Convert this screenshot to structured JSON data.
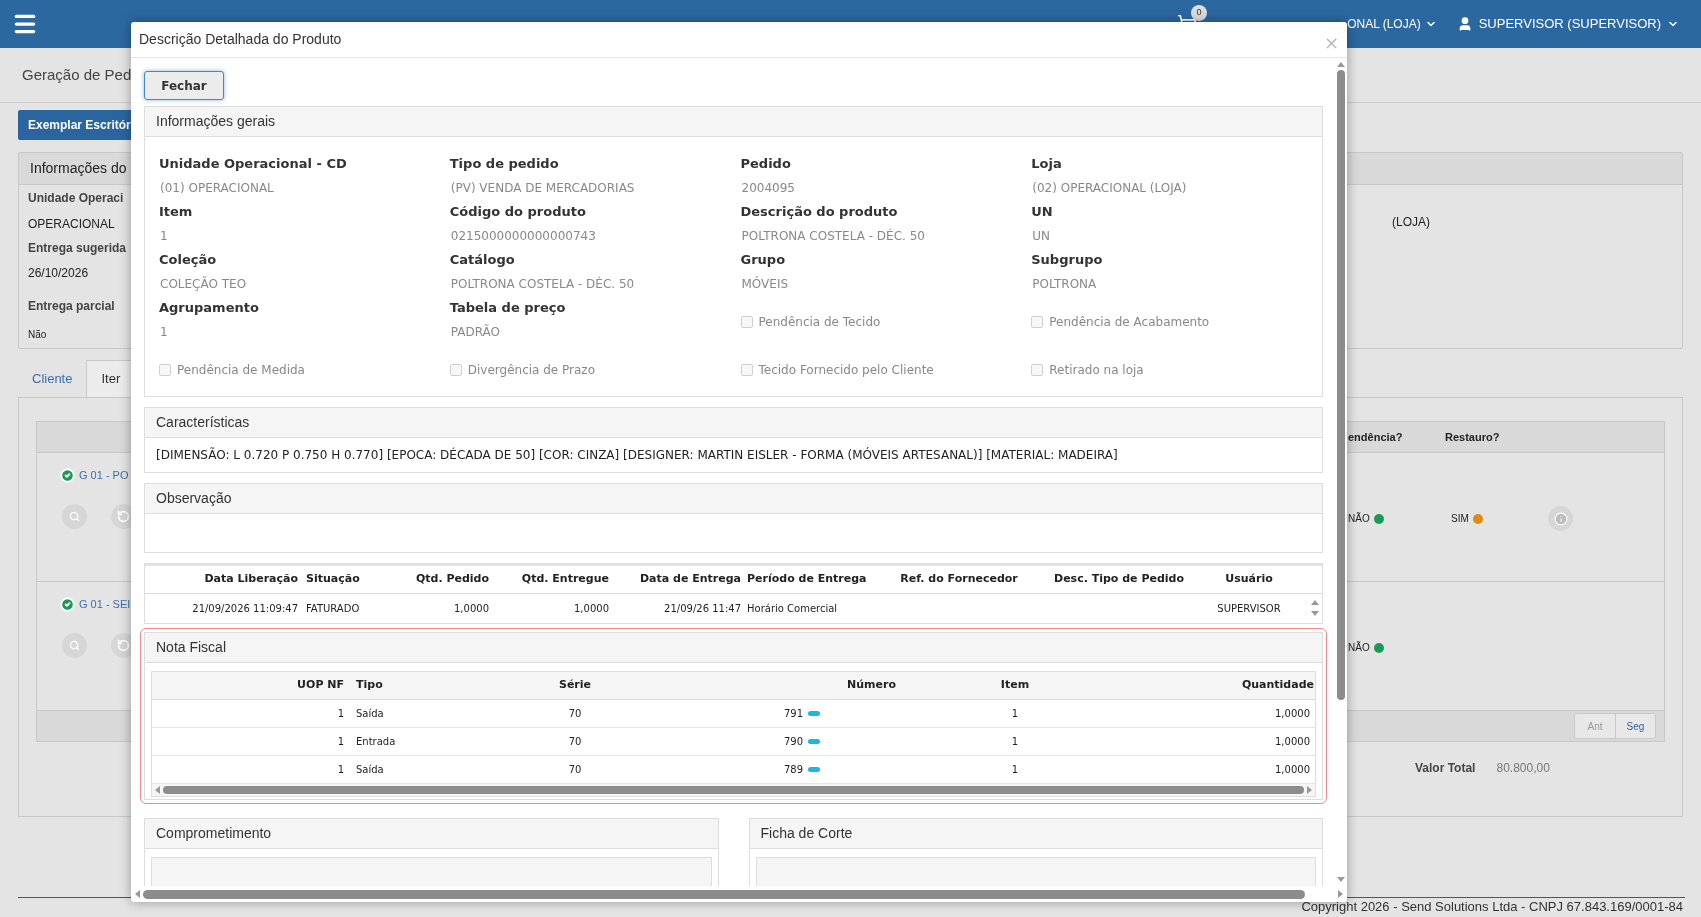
{
  "topbar": {
    "cart_count": "0",
    "store": "ONAL (LOJA)",
    "user": "SUPERVISOR (SUPERVISOR)"
  },
  "page": {
    "breadcrumb": "Geração de Ped",
    "button": "Exemplar Escritór",
    "info_panel": {
      "title": "Informações do",
      "left": [
        "Unidade Operaci",
        "OPERACIONAL",
        "Entrega sugerida",
        "26/10/2026",
        "Entrega parcial",
        "Não"
      ],
      "right": "(LOJA)"
    },
    "tabs": [
      {
        "label": "Cliente",
        "selected": false
      },
      {
        "label": "Iter",
        "selected": true
      }
    ],
    "items": {
      "columns": [
        "endência?",
        "Restauro?"
      ],
      "rows": [
        {
          "product": "G 01 - PO",
          "pendencia": {
            "text": "NÃO",
            "color": "#1a9a55"
          },
          "restauro": {
            "text": "SIM",
            "color": "#e08a14"
          }
        },
        {
          "product": "G 01 - SEI",
          "pendencia": {
            "text": "NÃO",
            "color": "#1a9a55"
          }
        }
      ],
      "pager": [
        {
          "label": "Ant",
          "disabled": true
        },
        {
          "label": "Seg",
          "disabled": false
        }
      ],
      "total_label": "Valor Total",
      "total_value": "80.800,00"
    },
    "copyright": "Copyright 2026 - Send Solutions Ltda - CNPJ 67.843.169/0001-84"
  },
  "modal": {
    "title": "Descrição Detalhada do Produto",
    "close": "×",
    "close_button": "Fechar",
    "general": {
      "title": "Informações gerais",
      "fields": [
        {
          "kind": "field",
          "label": "Unidade Operacional - CD",
          "value": "(01) OPERACIONAL"
        },
        {
          "kind": "field",
          "label": "Tipo de pedido",
          "value": "(PV) VENDA DE MERCADORIAS"
        },
        {
          "kind": "field",
          "label": "Pedido",
          "value": "2004095"
        },
        {
          "kind": "field",
          "label": "Loja",
          "value": "(02) OPERACIONAL (LOJA)"
        },
        {
          "kind": "field",
          "label": "Item",
          "value": "1"
        },
        {
          "kind": "field",
          "label": "Código do produto",
          "value": "0215000000000000743"
        },
        {
          "kind": "field",
          "label": "Descrição do produto",
          "value": "POLTRONA COSTELA - DÉC. 50"
        },
        {
          "kind": "field",
          "label": "UN",
          "value": "UN"
        },
        {
          "kind": "field",
          "label": "Coleção",
          "value": "COLEÇÃO TEO"
        },
        {
          "kind": "field",
          "label": "Catálogo",
          "value": "POLTRONA COSTELA - DÉC. 50"
        },
        {
          "kind": "field",
          "label": "Grupo",
          "value": "MÓVEIS"
        },
        {
          "kind": "field",
          "label": "Subgrupo",
          "value": "POLTRONA"
        },
        {
          "kind": "field",
          "label": "Agrupamento",
          "value": "1"
        },
        {
          "kind": "field",
          "label": "Tabela de preço",
          "value": "PADRÃO"
        },
        {
          "kind": "checkbox",
          "label": "Pendência de Tecido",
          "checked": false
        },
        {
          "kind": "checkbox",
          "label": "Pendência de Acabamento",
          "checked": false
        },
        {
          "kind": "checkbox",
          "label": "Pendência de Medida",
          "checked": false
        },
        {
          "kind": "checkbox",
          "label": "Divergência de Prazo",
          "checked": false
        },
        {
          "kind": "checkbox",
          "label": "Tecido Fornecido pelo Cliente",
          "checked": false
        },
        {
          "kind": "checkbox",
          "label": "Retirado na loja",
          "checked": false
        }
      ]
    },
    "characteristics": {
      "title": "Características",
      "text": "[DIMENSÃO: L 0.720 P 0.750 H 0.770] [EPOCA: DÉCADA DE 50] [COR: CINZA] [DESIGNER: MARTIN EISLER - FORMA (MÓVEIS ARTESANAL)] [MATERIAL: MADEIRA]"
    },
    "observation": {
      "title": "Observação"
    },
    "delivery": {
      "columns": [
        "Data Liberação",
        "Situação",
        "Qtd. Pedido",
        "Qtd. Entregue",
        "Data de Entrega",
        "Período de Entrega",
        "Ref. do Fornecedor",
        "Desc. Tipo de Pedido",
        "Usuário"
      ],
      "rows": [
        [
          "21/09/2026 11:09:47",
          "FATURADO",
          "1,0000",
          "1,0000",
          "21/09/26 11:47",
          "Horário Comercial",
          "",
          "",
          "SUPERVISOR"
        ]
      ]
    },
    "invoice": {
      "title": "Nota Fiscal",
      "columns": [
        "UOP NF",
        "Tipo",
        "Série",
        "Número",
        "Item",
        "Quantidade"
      ],
      "rows": [
        [
          "1",
          "Saída",
          "70",
          "791",
          "1",
          "1,0000"
        ],
        [
          "1",
          "Entrada",
          "70",
          "790",
          "1",
          "1,0000"
        ],
        [
          "1",
          "Saída",
          "70",
          "789",
          "1",
          "1,0000"
        ]
      ]
    },
    "bottom_panels": [
      "Comprometimento",
      "Ficha de Corte"
    ]
  }
}
